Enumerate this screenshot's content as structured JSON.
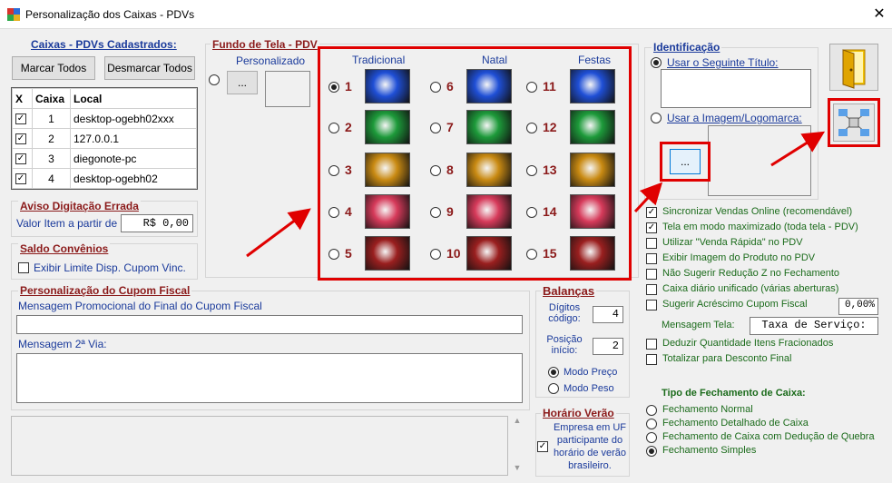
{
  "window": {
    "title": "Personalização dos Caixas - PDVs",
    "close_glyph": "✕"
  },
  "caixas": {
    "title": "Caixas - PDVs Cadastrados:",
    "mark_all": "Marcar Todos",
    "unmark_all": "Desmarcar Todos",
    "columns": [
      "X",
      "Caixa",
      "Local"
    ],
    "rows": [
      {
        "checked": true,
        "caixa": "1",
        "local": "desktop-ogebh02xxx"
      },
      {
        "checked": true,
        "caixa": "2",
        "local": "127.0.0.1"
      },
      {
        "checked": true,
        "caixa": "3",
        "local": "diegonote-pc"
      },
      {
        "checked": true,
        "caixa": "4",
        "local": "desktop-ogebh02"
      }
    ]
  },
  "aviso": {
    "title": "Aviso Digitação Errada",
    "label": "Valor Item a partir de",
    "value": "R$ 0,00"
  },
  "saldo": {
    "title": "Saldo Convênios",
    "label": "Exibir Limite Disp. Cupom Vinc."
  },
  "fundo": {
    "title": "Fundo de Tela - PDV",
    "personalizado": "Personalizado",
    "browse": "...",
    "columns": [
      "Tradicional",
      "Natal",
      "Festas"
    ],
    "selected": "1",
    "themes": [
      {
        "num": "1",
        "color": "#1f4fd6"
      },
      {
        "num": "6",
        "color": "#1f4fd6"
      },
      {
        "num": "11",
        "color": "#1f4fd6"
      },
      {
        "num": "2",
        "color": "#1d9a3a"
      },
      {
        "num": "7",
        "color": "#1d9a3a"
      },
      {
        "num": "12",
        "color": "#1d9a3a"
      },
      {
        "num": "3",
        "color": "#c98a12"
      },
      {
        "num": "8",
        "color": "#c98a12"
      },
      {
        "num": "13",
        "color": "#c98a12"
      },
      {
        "num": "4",
        "color": "#d63a5a"
      },
      {
        "num": "9",
        "color": "#d63a5a"
      },
      {
        "num": "14",
        "color": "#d63a5a"
      },
      {
        "num": "5",
        "color": "#9a1f1f"
      },
      {
        "num": "10",
        "color": "#9a1f1f"
      },
      {
        "num": "15",
        "color": "#9a1f1f"
      }
    ]
  },
  "identificacao": {
    "title": "Identificação",
    "use_title": "Usar o Seguinte Título:",
    "use_image": "Usar a Imagem/Logomarca:",
    "browse": "..."
  },
  "options": [
    {
      "label": "Sincronizar Vendas Online (recomendável)",
      "checked": true
    },
    {
      "label": "Tela em modo maximizado (toda tela - PDV)",
      "checked": true
    },
    {
      "label": "Utilizar \"Venda Rápida\" no PDV",
      "checked": false
    },
    {
      "label": "Exibir Imagem do Produto no PDV",
      "checked": false
    },
    {
      "label": "Não Sugerir Redução Z no Fechamento",
      "checked": false
    },
    {
      "label": "Caixa diário unificado (várias aberturas)",
      "checked": false
    },
    {
      "label": "Sugerir Acréscimo Cupom Fiscal",
      "checked": false
    }
  ],
  "acrescimo_value": "0,00%",
  "mensagem_tela": {
    "label": "Mensagem Tela:",
    "value": "Taxa de Serviço:"
  },
  "options2": [
    {
      "label": "Deduzir Quantidade Itens Fracionados",
      "checked": false
    },
    {
      "label": "Totalizar para Desconto Final",
      "checked": false
    }
  ],
  "fechamento": {
    "title": "Tipo de Fechamento de Caixa:",
    "options": [
      "Fechamento Normal",
      "Fechamento Detalhado de Caixa",
      "Fechamento de Caixa com Dedução de Quebra",
      "Fechamento Simples"
    ],
    "selected": 3
  },
  "cupom": {
    "title": "Personalização do Cupom Fiscal",
    "msg_final": "Mensagem Promocional do Final do Cupom Fiscal",
    "msg_2via": "Mensagem 2ª Via:"
  },
  "balancas": {
    "title": "Balanças",
    "digitos_label": "Dígitos código:",
    "digitos": "4",
    "posicao_label": "Posição início:",
    "posicao": "2",
    "modo_preco": "Modo Preço",
    "modo_peso": "Modo Peso"
  },
  "horario": {
    "title": "Horário Verão",
    "text": "Empresa em UF participante do horário de verão brasileiro."
  }
}
